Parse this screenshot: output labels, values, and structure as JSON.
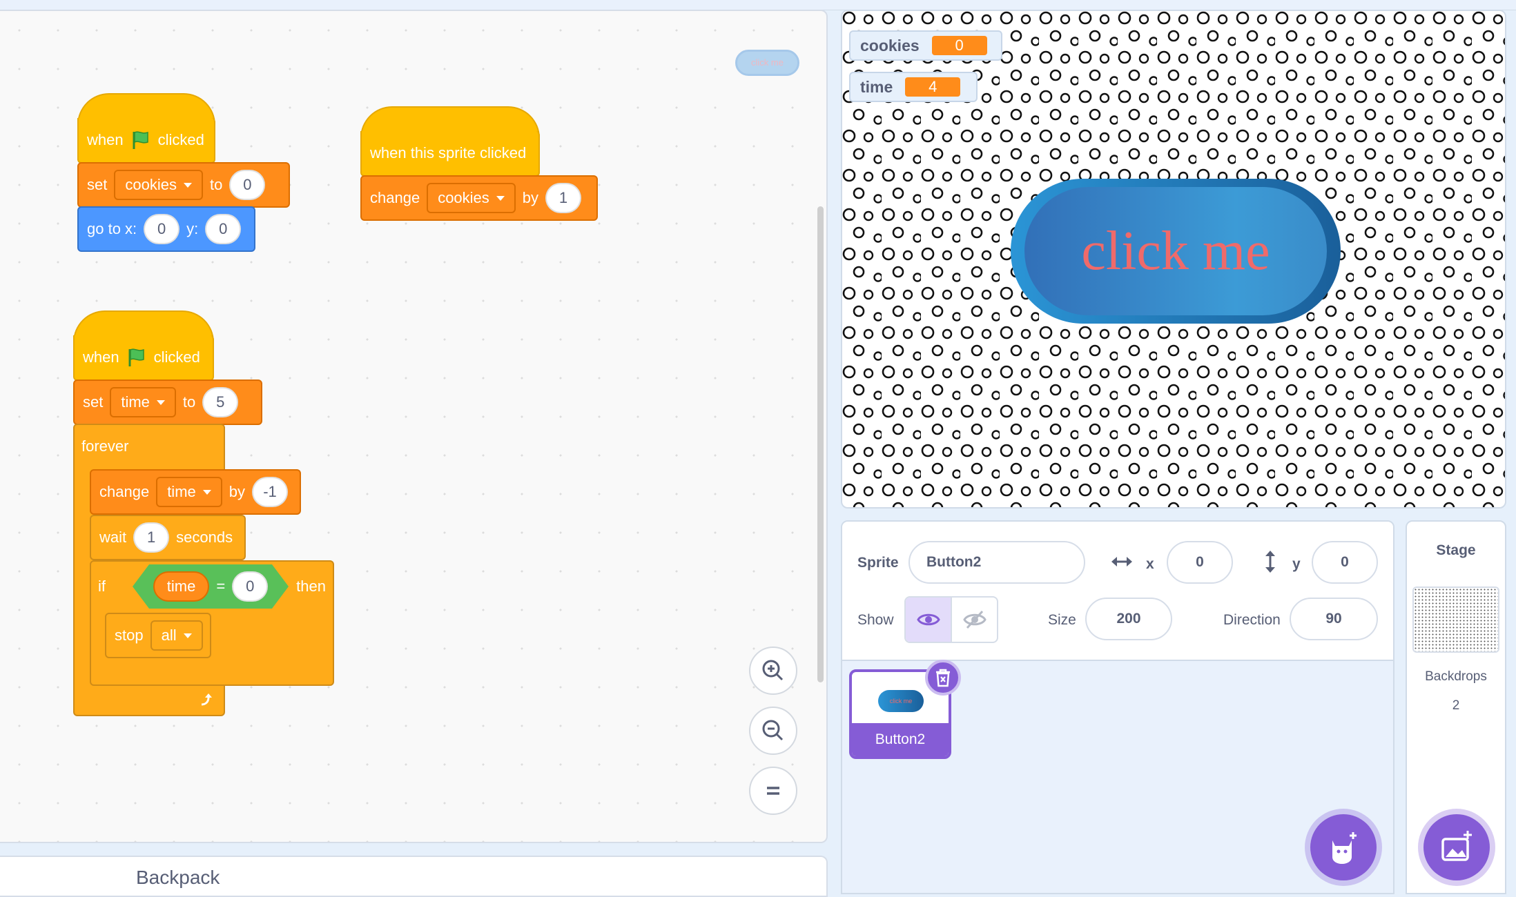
{
  "code_area": {
    "preview_sprite_text": "click me",
    "scripts": {
      "script1": {
        "hat": {
          "when": "when",
          "clicked": "clicked"
        },
        "set": {
          "label": "set",
          "variable": "cookies",
          "to": "to",
          "value": "0"
        },
        "goto": {
          "label": "go to x:",
          "x": "0",
          "y_label": "y:",
          "y": "0"
        }
      },
      "script2": {
        "hat": {
          "label": "when this sprite clicked"
        },
        "change": {
          "label": "change",
          "variable": "cookies",
          "by": "by",
          "value": "1"
        }
      },
      "script3": {
        "hat": {
          "when": "when",
          "clicked": "clicked"
        },
        "set": {
          "label": "set",
          "variable": "time",
          "to": "to",
          "value": "5"
        },
        "forever": {
          "label": "forever"
        },
        "change": {
          "label": "change",
          "variable": "time",
          "by": "by",
          "value": "-1"
        },
        "wait": {
          "label": "wait",
          "value": "1",
          "unit": "seconds"
        },
        "if": {
          "label": "if",
          "reporter": "time",
          "op": "=",
          "value": "0",
          "then": "then"
        },
        "stop": {
          "label": "stop",
          "option": "all"
        }
      }
    }
  },
  "stage": {
    "monitors": [
      {
        "name": "cookies",
        "value": "0"
      },
      {
        "name": "time",
        "value": "4"
      }
    ],
    "button_text": "click me"
  },
  "sprite_info": {
    "sprite_label": "Sprite",
    "sprite_name": "Button2",
    "x_label": "x",
    "x": "0",
    "y_label": "y",
    "y": "0",
    "show_label": "Show",
    "size_label": "Size",
    "size": "200",
    "direction_label": "Direction",
    "direction": "90"
  },
  "sprite_list": [
    {
      "name": "Button2",
      "thumb_text": "click me"
    }
  ],
  "stage_pane": {
    "title": "Stage",
    "backdrops_label": "Backdrops",
    "backdrops_count": "2"
  },
  "backpack": {
    "label": "Backpack"
  },
  "colors": {
    "events": "#ffbf00",
    "variables": "#ff8c1a",
    "motion": "#4c97ff",
    "control": "#ffab19",
    "operators": "#59c059",
    "accent": "#855cd6"
  }
}
